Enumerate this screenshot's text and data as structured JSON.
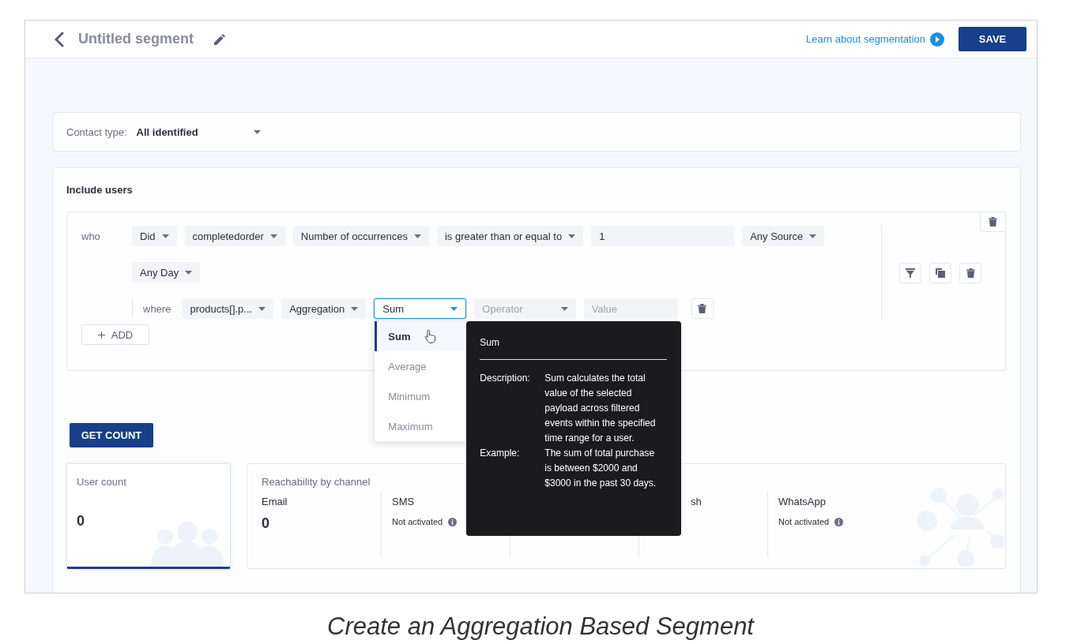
{
  "header": {
    "title": "Untitled segment",
    "help_link": "Learn about segmentation",
    "save_button": "SAVE"
  },
  "contact_type": {
    "label": "Contact type:",
    "value": "All identified"
  },
  "include_users": {
    "title": "Include users",
    "who_label": "who",
    "conditions": [
      {
        "kind": "dropdown",
        "text": "Did"
      },
      {
        "kind": "dropdown",
        "text": "completedorder"
      },
      {
        "kind": "dropdown",
        "text": "Number of occurrences"
      },
      {
        "kind": "dropdown",
        "text": "is greater than or equal to"
      },
      {
        "kind": "input",
        "text": "1"
      },
      {
        "kind": "dropdown",
        "text": "Any Source"
      }
    ],
    "time": [
      {
        "kind": "dropdown",
        "text": "Any Day"
      }
    ],
    "where_label": "where",
    "filters": [
      {
        "kind": "dropdown",
        "text": "products[].p..."
      },
      {
        "kind": "dropdown",
        "text": "Aggregation"
      },
      {
        "kind": "select",
        "text": "Sum",
        "focused": true
      },
      {
        "kind": "dropdown",
        "placeholder": "Operator"
      },
      {
        "kind": "input",
        "placeholder": "Value"
      }
    ],
    "add_button": "ADD"
  },
  "aggregation_menu": [
    {
      "label": "Sum",
      "selected": true
    },
    {
      "label": "Average",
      "selected": false
    },
    {
      "label": "Minimum",
      "selected": false
    },
    {
      "label": "Maximum",
      "selected": false
    }
  ],
  "tooltip": {
    "title": "Sum",
    "rows": [
      {
        "label": "Description:",
        "text": "Sum calculates the total value of the selected payload across filtered events within the specified time range for a user."
      },
      {
        "label": "Example:",
        "text": "The sum of total purchase is between $2000 and $3000 in the past 30 days."
      }
    ]
  },
  "get_count_button": "GET COUNT",
  "user_count": {
    "label": "User count",
    "value": "0"
  },
  "reachability": {
    "title": "Reachability by channel",
    "channels": [
      {
        "kind": "count",
        "name": "Email",
        "value": "0"
      },
      {
        "kind": "status",
        "name": "SMS",
        "status": "Not activated"
      },
      {
        "kind": "hidden"
      },
      {
        "kind": "covered",
        "name": "sh"
      },
      {
        "kind": "status",
        "name": "WhatsApp",
        "status": "Not activated"
      }
    ]
  },
  "caption": "Create an Aggregation Based Segment"
}
